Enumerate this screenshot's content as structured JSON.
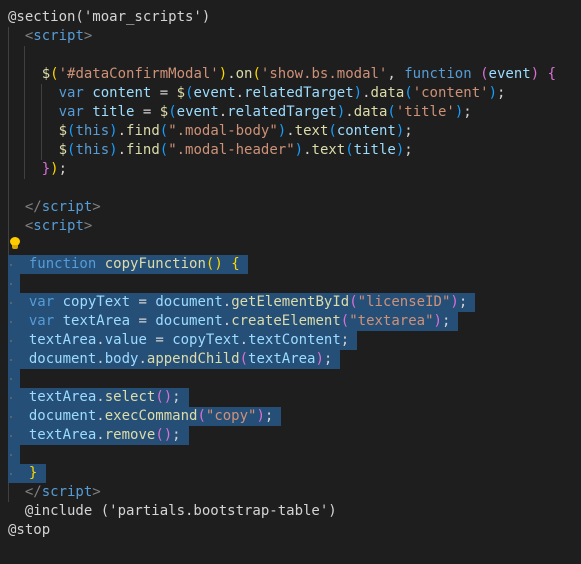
{
  "colors": {
    "background": "#1e1e1e",
    "selection": "#264f78",
    "keyword": "#569cd6",
    "function": "#dcdcaa",
    "variable": "#9cdcfe",
    "string": "#ce9178",
    "default": "#d4d4d4",
    "tag_bracket": "#808080",
    "bracket_gold": "#ffd700",
    "bracket_purple": "#da70d6",
    "bracket_blue": "#179fff",
    "lightbulb": "#ffcc00"
  },
  "icons": [
    "lightbulb-icon"
  ],
  "lines": [
    {
      "tokens": [
        [
          "@section('moar_scripts')",
          "def"
        ]
      ]
    },
    {
      "tokens": [
        [
          "  ",
          "def"
        ],
        [
          "<",
          "tag"
        ],
        [
          "script",
          "tagname"
        ],
        [
          ">",
          "tag"
        ]
      ]
    },
    {
      "tokens": []
    },
    {
      "tokens": [
        [
          "    ",
          "def"
        ],
        [
          "$",
          "fn"
        ],
        [
          "(",
          "br1"
        ],
        [
          "'#dataConfirmModal'",
          "str"
        ],
        [
          ")",
          "br1"
        ],
        [
          ".",
          "def"
        ],
        [
          "on",
          "fn"
        ],
        [
          "(",
          "br1"
        ],
        [
          "'show.bs.modal'",
          "str"
        ],
        [
          ", ",
          "def"
        ],
        [
          "function",
          "kw"
        ],
        [
          " ",
          "def"
        ],
        [
          "(",
          "br2"
        ],
        [
          "event",
          "var"
        ],
        [
          ")",
          "br2"
        ],
        [
          " ",
          "def"
        ],
        [
          "{",
          "br2"
        ]
      ]
    },
    {
      "tokens": [
        [
          "      ",
          "def"
        ],
        [
          "var",
          "kw"
        ],
        [
          " ",
          "def"
        ],
        [
          "content",
          "var"
        ],
        [
          " = ",
          "def"
        ],
        [
          "$",
          "fn"
        ],
        [
          "(",
          "br3"
        ],
        [
          "event",
          "var"
        ],
        [
          ".",
          "def"
        ],
        [
          "relatedTarget",
          "var"
        ],
        [
          ")",
          "br3"
        ],
        [
          ".",
          "def"
        ],
        [
          "data",
          "fn"
        ],
        [
          "(",
          "br3"
        ],
        [
          "'content'",
          "str"
        ],
        [
          ")",
          "br3"
        ],
        [
          ";",
          "def"
        ]
      ]
    },
    {
      "tokens": [
        [
          "      ",
          "def"
        ],
        [
          "var",
          "kw"
        ],
        [
          " ",
          "def"
        ],
        [
          "title",
          "var"
        ],
        [
          " = ",
          "def"
        ],
        [
          "$",
          "fn"
        ],
        [
          "(",
          "br3"
        ],
        [
          "event",
          "var"
        ],
        [
          ".",
          "def"
        ],
        [
          "relatedTarget",
          "var"
        ],
        [
          ")",
          "br3"
        ],
        [
          ".",
          "def"
        ],
        [
          "data",
          "fn"
        ],
        [
          "(",
          "br3"
        ],
        [
          "'title'",
          "str"
        ],
        [
          ")",
          "br3"
        ],
        [
          ";",
          "def"
        ]
      ]
    },
    {
      "tokens": [
        [
          "      ",
          "def"
        ],
        [
          "$",
          "fn"
        ],
        [
          "(",
          "br3"
        ],
        [
          "this",
          "kw"
        ],
        [
          ")",
          "br3"
        ],
        [
          ".",
          "def"
        ],
        [
          "find",
          "fn"
        ],
        [
          "(",
          "br3"
        ],
        [
          "\".modal-body\"",
          "str"
        ],
        [
          ")",
          "br3"
        ],
        [
          ".",
          "def"
        ],
        [
          "text",
          "fn"
        ],
        [
          "(",
          "br3"
        ],
        [
          "content",
          "var"
        ],
        [
          ")",
          "br3"
        ],
        [
          ";",
          "def"
        ]
      ]
    },
    {
      "tokens": [
        [
          "      ",
          "def"
        ],
        [
          "$",
          "fn"
        ],
        [
          "(",
          "br3"
        ],
        [
          "this",
          "kw"
        ],
        [
          ")",
          "br3"
        ],
        [
          ".",
          "def"
        ],
        [
          "find",
          "fn"
        ],
        [
          "(",
          "br3"
        ],
        [
          "\".modal-header\"",
          "str"
        ],
        [
          ")",
          "br3"
        ],
        [
          ".",
          "def"
        ],
        [
          "text",
          "fn"
        ],
        [
          "(",
          "br3"
        ],
        [
          "title",
          "var"
        ],
        [
          ")",
          "br3"
        ],
        [
          ";",
          "def"
        ]
      ]
    },
    {
      "tokens": [
        [
          "    ",
          "def"
        ],
        [
          "}",
          "br2"
        ],
        [
          ")",
          "br1"
        ],
        [
          ";",
          "def"
        ]
      ]
    },
    {
      "tokens": []
    },
    {
      "tokens": [
        [
          "  ",
          "def"
        ],
        [
          "</",
          "tag"
        ],
        [
          "script",
          "tagname"
        ],
        [
          ">",
          "tag"
        ]
      ]
    },
    {
      "tokens": [
        [
          "  ",
          "def"
        ],
        [
          "<",
          "tag"
        ],
        [
          "script",
          "tagname"
        ],
        [
          ">",
          "tag"
        ]
      ]
    },
    {
      "tokens": []
    },
    {
      "selected": true,
      "tokens": [
        [
          "  ",
          "def"
        ],
        [
          "function",
          "kw"
        ],
        [
          " ",
          "def"
        ],
        [
          "copyFunction",
          "fn"
        ],
        [
          "()",
          "br1"
        ],
        [
          " ",
          "def"
        ],
        [
          "{",
          "br1"
        ]
      ]
    },
    {
      "selected": true,
      "tokens": []
    },
    {
      "selected": true,
      "tokens": [
        [
          "  ",
          "def"
        ],
        [
          "var",
          "kw"
        ],
        [
          " ",
          "def"
        ],
        [
          "copyText",
          "var"
        ],
        [
          " = ",
          "def"
        ],
        [
          "document",
          "var"
        ],
        [
          ".",
          "def"
        ],
        [
          "getElementById",
          "fn"
        ],
        [
          "(",
          "br2"
        ],
        [
          "\"licenseID\"",
          "str"
        ],
        [
          ")",
          "br2"
        ],
        [
          ";",
          "def"
        ]
      ]
    },
    {
      "selected": true,
      "tokens": [
        [
          "  ",
          "def"
        ],
        [
          "var",
          "kw"
        ],
        [
          " ",
          "def"
        ],
        [
          "textArea",
          "var"
        ],
        [
          " = ",
          "def"
        ],
        [
          "document",
          "var"
        ],
        [
          ".",
          "def"
        ],
        [
          "createElement",
          "fn"
        ],
        [
          "(",
          "br2"
        ],
        [
          "\"textarea\"",
          "str"
        ],
        [
          ")",
          "br2"
        ],
        [
          ";",
          "def"
        ]
      ]
    },
    {
      "selected": true,
      "tokens": [
        [
          "  ",
          "def"
        ],
        [
          "textArea",
          "var"
        ],
        [
          ".",
          "def"
        ],
        [
          "value",
          "var"
        ],
        [
          " = ",
          "def"
        ],
        [
          "copyText",
          "var"
        ],
        [
          ".",
          "def"
        ],
        [
          "textContent",
          "var"
        ],
        [
          ";",
          "def"
        ]
      ]
    },
    {
      "selected": true,
      "tokens": [
        [
          "  ",
          "def"
        ],
        [
          "document",
          "var"
        ],
        [
          ".",
          "def"
        ],
        [
          "body",
          "var"
        ],
        [
          ".",
          "def"
        ],
        [
          "appendChild",
          "fn"
        ],
        [
          "(",
          "br2"
        ],
        [
          "textArea",
          "var"
        ],
        [
          ")",
          "br2"
        ],
        [
          ";",
          "def"
        ]
      ]
    },
    {
      "selected": true,
      "tokens": []
    },
    {
      "selected": true,
      "tokens": [
        [
          "  ",
          "def"
        ],
        [
          "textArea",
          "var"
        ],
        [
          ".",
          "def"
        ],
        [
          "select",
          "fn"
        ],
        [
          "()",
          "br2"
        ],
        [
          ";",
          "def"
        ]
      ]
    },
    {
      "selected": true,
      "tokens": [
        [
          "  ",
          "def"
        ],
        [
          "document",
          "var"
        ],
        [
          ".",
          "def"
        ],
        [
          "execCommand",
          "fn"
        ],
        [
          "(",
          "br2"
        ],
        [
          "\"copy\"",
          "str"
        ],
        [
          ")",
          "br2"
        ],
        [
          ";",
          "def"
        ]
      ]
    },
    {
      "selected": true,
      "tokens": [
        [
          "  ",
          "def"
        ],
        [
          "textArea",
          "var"
        ],
        [
          ".",
          "def"
        ],
        [
          "remove",
          "fn"
        ],
        [
          "()",
          "br2"
        ],
        [
          ";",
          "def"
        ]
      ]
    },
    {
      "selected": true,
      "tokens": []
    },
    {
      "selected": true,
      "tokens": [
        [
          "  ",
          "def"
        ],
        [
          "}",
          "br1"
        ]
      ]
    },
    {
      "tokens": [
        [
          "  ",
          "def"
        ],
        [
          "</",
          "tag"
        ],
        [
          "script",
          "tagname"
        ],
        [
          ">",
          "tag"
        ]
      ]
    },
    {
      "tokens": [
        [
          "  ",
          "def"
        ],
        [
          "@include ('partials.bootstrap-table')",
          "def"
        ]
      ]
    },
    {
      "tokens": [
        [
          "@stop",
          "def"
        ]
      ]
    }
  ]
}
